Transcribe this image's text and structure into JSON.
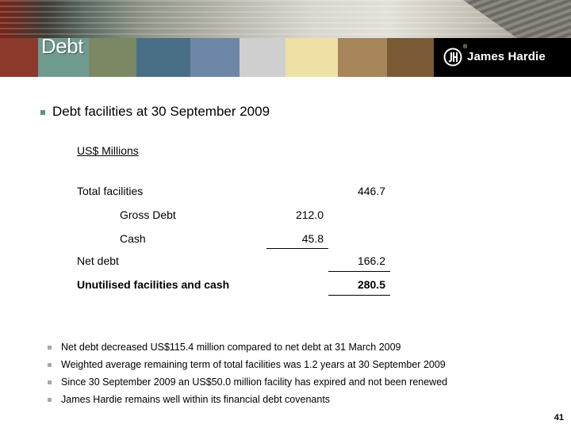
{
  "header": {
    "title": "Debt",
    "logo_text": "James Hardie",
    "logo_reg": "®",
    "swatch_colors": [
      "#8b3a2b",
      "#6f9a90",
      "#7b8863",
      "#486f86",
      "#6e86a6",
      "#cfcfcf",
      "#efe1a5",
      "#a6865a",
      "#7a5a34"
    ]
  },
  "main_bullet": "Debt facilities at 30 September 2009",
  "table": {
    "unit_label": "US$ Millions",
    "rows": [
      {
        "label": "Total facilities",
        "mid": "",
        "right": "446.7"
      },
      {
        "label": "Gross Debt",
        "mid": "212.0",
        "right": ""
      },
      {
        "label": "Cash",
        "mid": "45.8",
        "right": ""
      },
      {
        "label": "Net debt",
        "mid": "",
        "right": "166.2"
      },
      {
        "label": "Unutilised facilities and cash",
        "mid": "",
        "right": "280.5"
      }
    ]
  },
  "notes": [
    "Net debt decreased US$115.4 million compared to net debt at 31 March 2009",
    "Weighted average remaining term of total facilities was 1.2 years at 30 September 2009",
    "Since 30 September 2009 an US$50.0 million facility has expired and not been renewed",
    "James Hardie remains well within its financial debt covenants"
  ],
  "page_number": "41"
}
